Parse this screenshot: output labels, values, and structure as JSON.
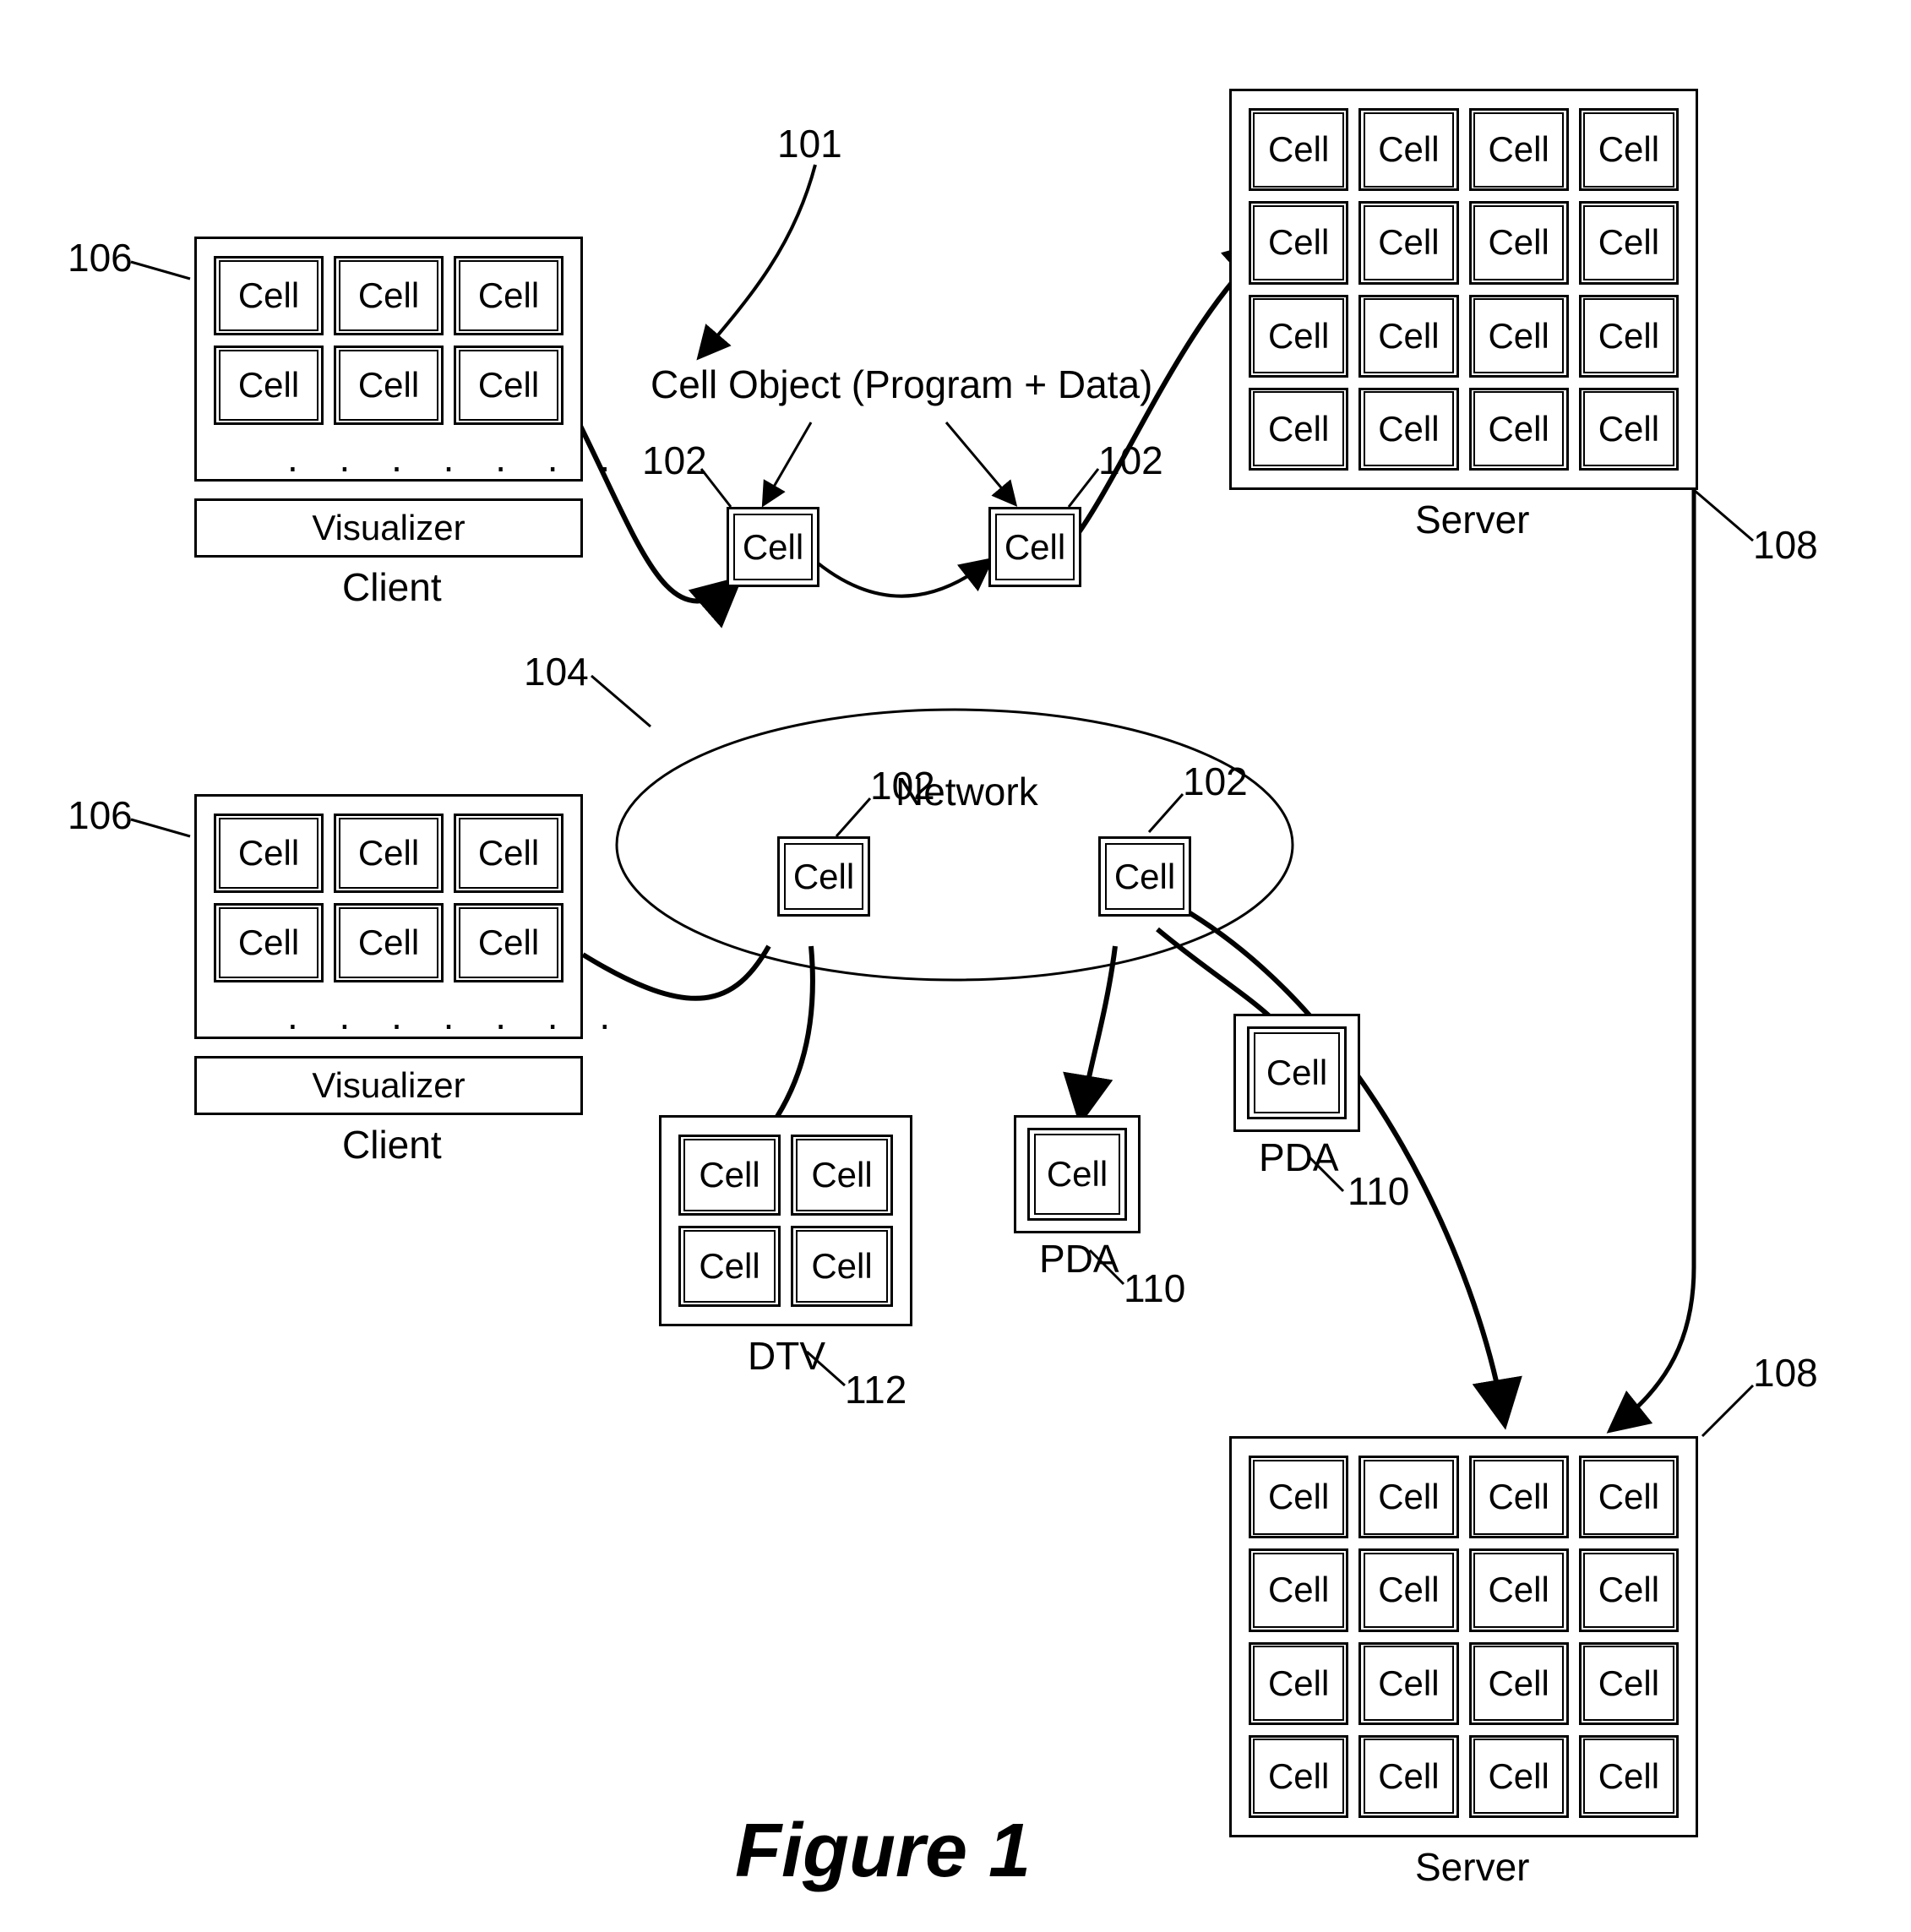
{
  "figure_title": "Figure 1",
  "refs": {
    "r101": "101",
    "r102a": "102",
    "r102b": "102",
    "r102c": "102",
    "r102d": "102",
    "r104": "104",
    "r106a": "106",
    "r106b": "106",
    "r108a": "108",
    "r108b": "108",
    "r110a": "110",
    "r110b": "110",
    "r112": "112"
  },
  "labels": {
    "cell_object": "Cell Object (Program + Data)",
    "network": "Network",
    "client": "Client",
    "visualizer": "Visualizer",
    "server": "Server",
    "pda": "PDA",
    "dtv": "DTV",
    "cell": "Cell",
    "dots": ". . . . . . ."
  }
}
